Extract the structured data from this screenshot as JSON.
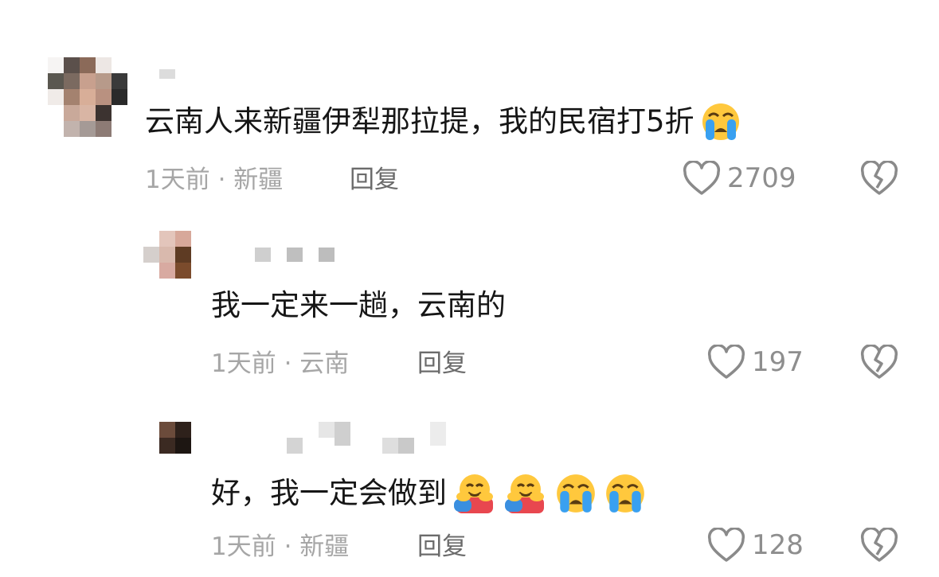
{
  "comments": [
    {
      "text": "云南人来新疆伊犁那拉提，我的民宿打5折",
      "emojis": [
        "loudly-crying-face"
      ],
      "time": "1天前",
      "location": "新疆",
      "reply_label": "回复",
      "likes": "2709"
    },
    {
      "text": "我一定来一趟，云南的",
      "emojis": [],
      "time": "1天前",
      "location": "云南",
      "reply_label": "回复",
      "likes": "197"
    },
    {
      "text": "好，我一定会做到",
      "emojis": [
        "hugging-face",
        "hugging-face",
        "loudly-crying-face",
        "loudly-crying-face"
      ],
      "time": "1天前",
      "location": "新疆",
      "reply_label": "回复",
      "likes": "128"
    }
  ],
  "separator": " · ",
  "icons": {
    "like": "heart-outline-icon",
    "dislike": "broken-heart-icon"
  },
  "colors": {
    "text": "#161616",
    "meta": "#a6a6a6",
    "reply": "#6b6b6b",
    "icon": "#8a8a8a"
  }
}
